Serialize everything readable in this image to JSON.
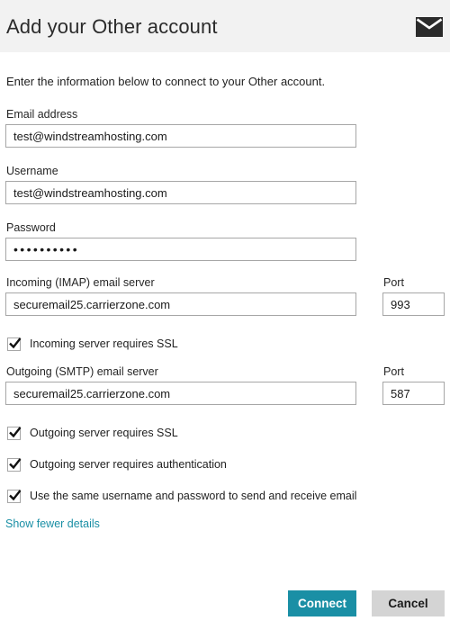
{
  "header": {
    "title": "Add your Other account",
    "icon": "mail-envelope-icon"
  },
  "main": {
    "intro": "Enter the information below to connect to your Other account.",
    "fields": [
      {
        "label": "Email address",
        "value": "test@windstreamhosting.com",
        "placeholder": ""
      },
      {
        "label": "Username",
        "value": "test@windstreamhosting.com",
        "placeholder": ""
      },
      {
        "label": "Password",
        "value": "••••••••••",
        "placeholder": ""
      }
    ],
    "incoming": {
      "label": "Incoming (IMAP) email server",
      "value": "securemail25.carrierzone.com",
      "port_label": "Port",
      "port_value": "993"
    },
    "outgoing": {
      "label": "Outgoing (SMTP) email server",
      "value": "securemail25.carrierzone.com",
      "port_label": "Port",
      "port_value": "587"
    },
    "checkboxes": [
      {
        "label": "Incoming server requires SSL",
        "checked": true
      },
      {
        "label": "Outgoing server requires SSL",
        "checked": true
      },
      {
        "label": "Outgoing server requires authentication",
        "checked": true
      },
      {
        "label": "Use the same username and password to send and receive email",
        "checked": true
      }
    ],
    "details_link": "Show fewer details"
  },
  "footer": {
    "connect_label": "Connect",
    "cancel_label": "Cancel"
  },
  "colors": {
    "accent": "#1a8fa5",
    "header_bg": "#f2f2f2",
    "cancel_bg": "#d4d4d4",
    "input_border": "#a6a6a6"
  }
}
